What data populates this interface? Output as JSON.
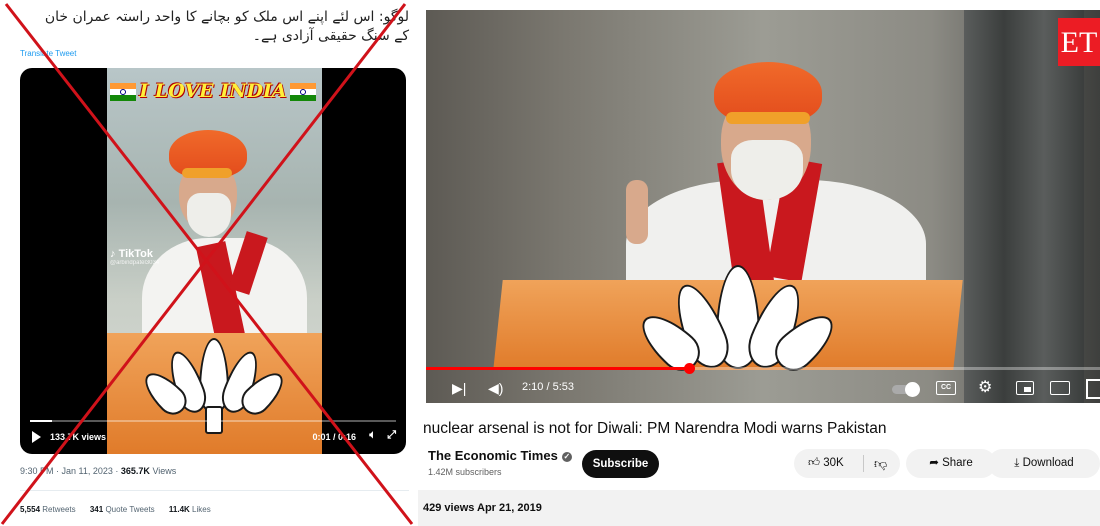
{
  "tweet": {
    "text_line1": "لوگو: اس لئے اپنے اس ملک کو بچانے کا واحد راستہ عمران خان",
    "text_line2": "کے سنگ حقیقی آزادی ہے۔",
    "translate_label": "Translate Tweet",
    "video": {
      "banner_text": "I LOVE INDIA",
      "watermark_brand": "TikTok",
      "watermark_handle": "@arbindpatel3034",
      "views_label": "133.7K views",
      "time_label": "0:01 / 0:16",
      "progress": 0.06,
      "icons": [
        "play-icon",
        "volume-icon",
        "expand-icon"
      ]
    },
    "timestamp": "9:30 PM · Jan 11, 2023",
    "views_count": "365.7K",
    "views_word": "Views",
    "stats": [
      {
        "count": "5,554",
        "label": "Retweets"
      },
      {
        "count": "341",
        "label": "Quote Tweets"
      },
      {
        "count": "11.4K",
        "label": "Likes"
      }
    ]
  },
  "cross_color": "#d0121a",
  "youtube": {
    "brand_logo": "ET",
    "player": {
      "time_label": "2:10 / 5:53",
      "progress": 0.39,
      "icons": [
        "next-icon",
        "volume-icon",
        "autoplay-toggle",
        "cc-icon",
        "settings-icon",
        "miniplayer-icon",
        "theater-icon",
        "fullscreen-icon"
      ]
    },
    "title": "nuclear arsenal is not for Diwali: PM Narendra Modi warns Pakistan",
    "channel": {
      "name": "The Economic Times",
      "subscribers": "1.42M subscribers"
    },
    "subscribe_label": "Subscribe",
    "likes": "30K",
    "share_label": "Share",
    "download_label": "Download",
    "description_meta": "429 views  Apr 21, 2019",
    "accent": "#ff0000"
  }
}
